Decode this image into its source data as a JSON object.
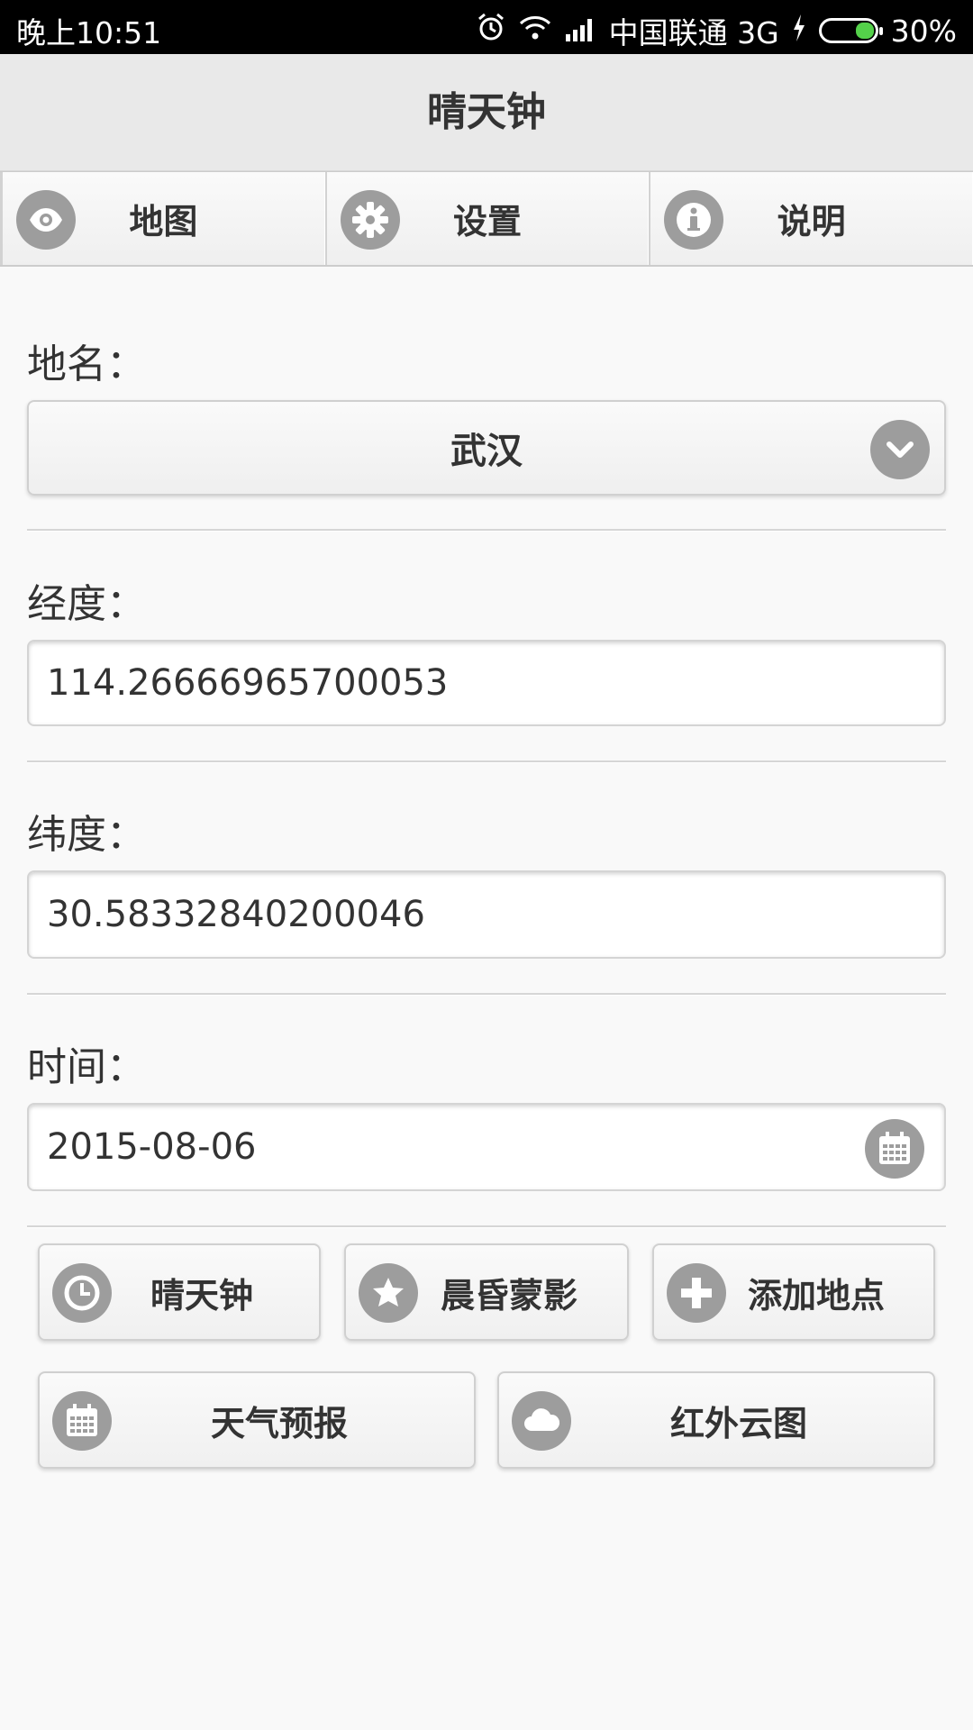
{
  "status_bar": {
    "time": "晚上10:51",
    "carrier": "中国联通 3G",
    "battery": "30%"
  },
  "header": {
    "title": "晴天钟"
  },
  "nav": [
    {
      "label": "地图",
      "icon": "eye-icon"
    },
    {
      "label": "设置",
      "icon": "gear-icon"
    },
    {
      "label": "说明",
      "icon": "info-icon"
    }
  ],
  "form": {
    "place_label": "地名：",
    "place_value": "武汉",
    "longitude_label": "经度：",
    "longitude_value": "114.26666965700053",
    "latitude_label": "纬度：",
    "latitude_value": "30.58332840200046",
    "time_label": "时间：",
    "time_value": "2015-08-06"
  },
  "actions": [
    {
      "label": "晴天钟",
      "icon": "clock-icon"
    },
    {
      "label": "晨昏蒙影",
      "icon": "star-icon"
    },
    {
      "label": "添加地点",
      "icon": "plus-icon"
    },
    {
      "label": "天气预报",
      "icon": "calendar-icon"
    },
    {
      "label": "红外云图",
      "icon": "cloud-icon"
    }
  ],
  "colors": {
    "icon_bg": "#9d9d9d",
    "battery_level": "#54d14a",
    "header_bg": "#e9e9e9"
  }
}
